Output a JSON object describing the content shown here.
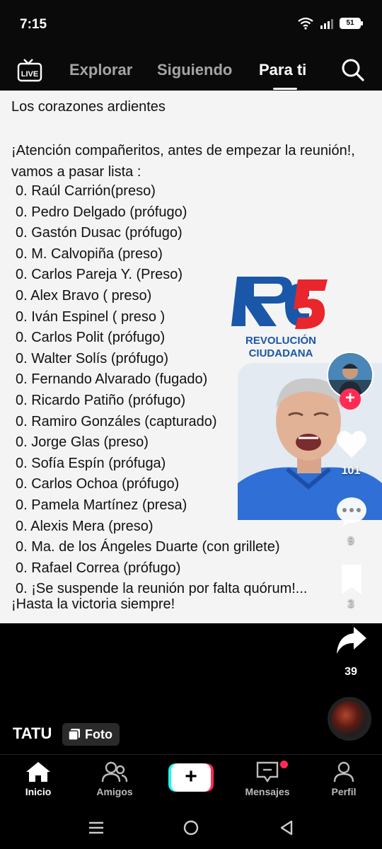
{
  "status_bar": {
    "time": "7:15",
    "battery": "51"
  },
  "top_nav": {
    "live_label": "LIVE",
    "tabs": [
      {
        "label": "Explorar"
      },
      {
        "label": "Siguiendo"
      },
      {
        "label": "Para ti"
      }
    ]
  },
  "post": {
    "header": "Los corazones ardientes",
    "intro": "¡Atención compañeritos, antes de empezar la reunión!, vamos a pasar lista :",
    "list": [
      "0. Raúl Carrión(preso)",
      "0. Pedro Delgado (prófugo)",
      "0. Gastón Dusac (prófugo)",
      "0. M. Calvopiña (preso)",
      "0. Carlos Pareja Y. (Preso)",
      "0. Alex Bravo ( preso)",
      "0. Iván Espinel ( preso )",
      "0. Carlos Polit (prófugo)",
      "0. Walter Solís (prófugo)",
      "0. Fernando Alvarado (fugado)",
      "0. Ricardo Patiño (prófugo)",
      "0. Ramiro Gonzáles (capturado)",
      "0. Jorge Glas (preso)",
      "0. Sofía Espín (prófuga)",
      "0. Carlos Ochoa (prófugo)",
      "0. Pamela Martínez (presa)",
      "0. Alexis Mera (preso)",
      "0. Ma. de los Ángeles Duarte (con grillete)",
      "0. Rafael Correa (prófugo)",
      "0. ¡Se suspende la reunión por falta quórum!..."
    ],
    "closing": "¡Hasta la victoria siempre!",
    "logo_line1": "REVOLUCIÓN",
    "logo_line2": "CIUDADANA"
  },
  "actions": {
    "likes": "101",
    "comments": "9",
    "saves": "3",
    "shares": "39"
  },
  "author": {
    "username": "TATU",
    "badge": "Foto"
  },
  "bottom_tabs": [
    {
      "label": "Inicio"
    },
    {
      "label": "Amigos"
    },
    {
      "label": "Mensajes"
    },
    {
      "label": "Perfil"
    }
  ],
  "colors": {
    "accent": "#fe2c55",
    "accent_cyan": "#25f4ee",
    "logo_blue": "#1a57a8",
    "logo_red": "#e8262b",
    "background": "#000000"
  }
}
